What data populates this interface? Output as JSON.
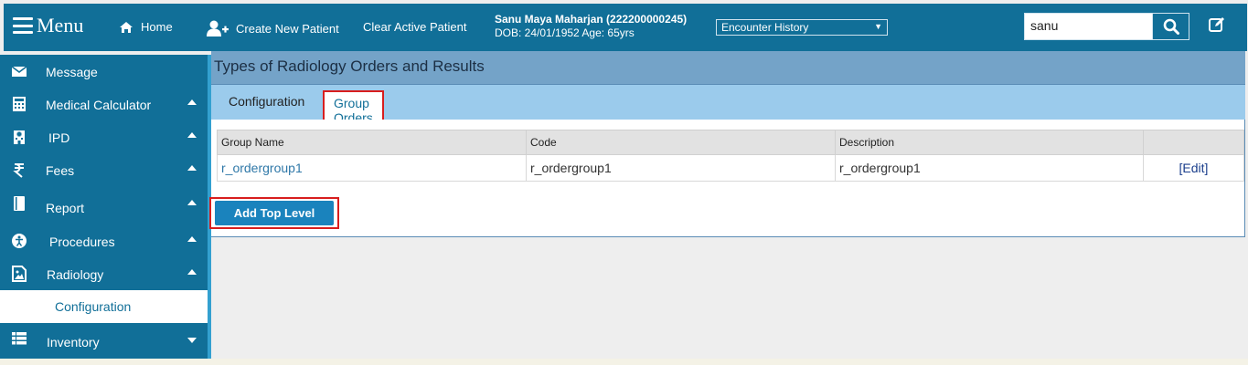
{
  "header": {
    "menu_label": "Menu",
    "home_label": "Home",
    "create_patient_label": "Create New Patient",
    "clear_patient_label": "Clear Active Patient",
    "patient_name": "Sanu Maya Maharjan (222200000245)",
    "patient_info": "DOB: 24/01/1952 Age: 65yrs",
    "encounter_select_value": "Encounter History",
    "search_value": "sanu"
  },
  "sidebar": {
    "items": [
      {
        "label": "Message",
        "icon": "envelope-icon"
      },
      {
        "label": "Medical Calculator",
        "icon": "calculator-icon"
      },
      {
        "label": "IPD",
        "icon": "hospital-icon"
      },
      {
        "label": "Fees",
        "icon": "rupee-icon"
      },
      {
        "label": "Report",
        "icon": "book-icon"
      },
      {
        "label": "Procedures",
        "icon": "accessibility-icon"
      },
      {
        "label": "Radiology",
        "icon": "image-file-icon"
      },
      {
        "label": "Inventory",
        "icon": "list-icon"
      }
    ],
    "active_subitem": "Configuration"
  },
  "main": {
    "title": "Types of Radiology Orders and Results",
    "tabs": [
      "Configuration",
      "Group Orders"
    ],
    "active_tab": "Group Orders",
    "table": {
      "columns": [
        "Group Name",
        "Code",
        "Description",
        ""
      ],
      "rows": [
        {
          "group_name": "r_ordergroup1",
          "code": "r_ordergroup1",
          "description": "r_ordergroup1",
          "action": "[Edit]"
        }
      ]
    },
    "add_button_label": "Add Top Level"
  },
  "colors": {
    "brand": "#116f98",
    "highlight_border": "#d81e1e",
    "button": "#1a83bd"
  }
}
